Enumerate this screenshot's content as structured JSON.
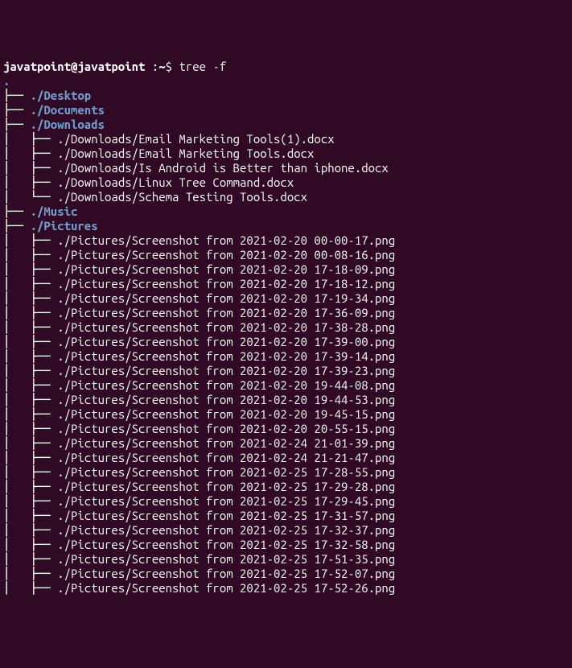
{
  "prompt": {
    "user_host": "javatpoint@javatpoint",
    "separator": " :",
    "path": "~",
    "symbol": "$ ",
    "command": "tree -f"
  },
  "root": ".",
  "dirs": {
    "desktop": "./Desktop",
    "documents": "./Documents",
    "downloads": "./Downloads",
    "music": "./Music",
    "pictures": "./Pictures"
  },
  "downloads_files": [
    "./Downloads/Email Marketing Tools(1).docx",
    "./Downloads/Email Marketing Tools.docx",
    "./Downloads/Is Android is Better than iphone.docx",
    "./Downloads/Linux Tree Command.docx",
    "./Downloads/Schema Testing Tools.docx"
  ],
  "pictures_files": [
    "./Pictures/Screenshot from 2021-02-20 00-00-17.png",
    "./Pictures/Screenshot from 2021-02-20 00-08-16.png",
    "./Pictures/Screenshot from 2021-02-20 17-18-09.png",
    "./Pictures/Screenshot from 2021-02-20 17-18-12.png",
    "./Pictures/Screenshot from 2021-02-20 17-19-34.png",
    "./Pictures/Screenshot from 2021-02-20 17-36-09.png",
    "./Pictures/Screenshot from 2021-02-20 17-38-28.png",
    "./Pictures/Screenshot from 2021-02-20 17-39-00.png",
    "./Pictures/Screenshot from 2021-02-20 17-39-14.png",
    "./Pictures/Screenshot from 2021-02-20 17-39-23.png",
    "./Pictures/Screenshot from 2021-02-20 19-44-08.png",
    "./Pictures/Screenshot from 2021-02-20 19-44-53.png",
    "./Pictures/Screenshot from 2021-02-20 19-45-15.png",
    "./Pictures/Screenshot from 2021-02-20 20-55-15.png",
    "./Pictures/Screenshot from 2021-02-24 21-01-39.png",
    "./Pictures/Screenshot from 2021-02-24 21-21-47.png",
    "./Pictures/Screenshot from 2021-02-25 17-28-55.png",
    "./Pictures/Screenshot from 2021-02-25 17-29-28.png",
    "./Pictures/Screenshot from 2021-02-25 17-29-45.png",
    "./Pictures/Screenshot from 2021-02-25 17-31-57.png",
    "./Pictures/Screenshot from 2021-02-25 17-32-37.png",
    "./Pictures/Screenshot from 2021-02-25 17-32-58.png",
    "./Pictures/Screenshot from 2021-02-25 17-51-35.png",
    "./Pictures/Screenshot from 2021-02-25 17-52-07.png",
    "./Pictures/Screenshot from 2021-02-25 17-52-26.png"
  ],
  "tree_chars": {
    "tee": "├── ",
    "last": "└── ",
    "pipe": "│   ",
    "space": "    "
  }
}
